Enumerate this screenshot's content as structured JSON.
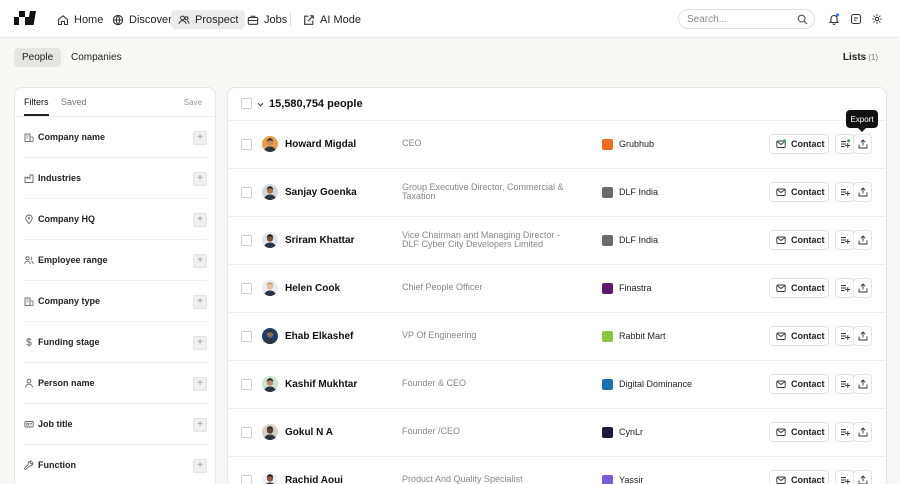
{
  "nav": {
    "items": [
      {
        "label": "Home",
        "icon": "home-icon"
      },
      {
        "label": "Discover",
        "icon": "globe-icon"
      },
      {
        "label": "Prospect",
        "icon": "users-icon",
        "active": true
      },
      {
        "label": "Jobs",
        "icon": "briefcase-icon"
      },
      {
        "label": "AI Mode",
        "icon": "ai-mode-icon"
      }
    ],
    "search_placeholder": "Search..."
  },
  "subnav": {
    "tabs": [
      {
        "label": "People",
        "active": true
      },
      {
        "label": "Companies"
      }
    ],
    "lists_label": "Lists",
    "lists_count": "(1)"
  },
  "filters": {
    "tabs": [
      "Filters",
      "Saved"
    ],
    "save_label": "Save",
    "items": [
      {
        "label": "Company name",
        "icon": "building-icon"
      },
      {
        "label": "Industries",
        "icon": "factory-icon"
      },
      {
        "label": "Company HQ",
        "icon": "location-pin-icon"
      },
      {
        "label": "Employee range",
        "icon": "people-icon"
      },
      {
        "label": "Company type",
        "icon": "building-icon"
      },
      {
        "label": "Funding stage",
        "icon": "dollar-icon"
      },
      {
        "label": "Person name",
        "icon": "person-icon"
      },
      {
        "label": "Job title",
        "icon": "badge-icon"
      },
      {
        "label": "Function",
        "icon": "wrench-icon"
      }
    ]
  },
  "results": {
    "count_label": "15,580,754 people",
    "contact_label": "Contact",
    "tooltip": "Export",
    "rows": [
      {
        "name": "Howard Migdal",
        "title": "CEO",
        "company": "Grubhub",
        "logo_color": "#f26b21"
      },
      {
        "name": "Sanjay Goenka",
        "title": "Group Executive Director, Commercial & Taxation",
        "company": "DLF India",
        "logo_color": "#6b6b6b"
      },
      {
        "name": "Sriram Khattar",
        "title": "Vice Chairman and Managing Director - DLF Cyber City Developers Limited",
        "company": "DLF India",
        "logo_color": "#6b6b6b"
      },
      {
        "name": "Helen Cook",
        "title": "Chief People Officer",
        "company": "Finastra",
        "logo_color": "#5b1a6e"
      },
      {
        "name": "Ehab Elkashef",
        "title": "VP Of Engineering",
        "company": "Rabbit Mart",
        "logo_color": "#8cc63f"
      },
      {
        "name": "Kashif Mukhtar",
        "title": "Founder & CEO",
        "company": "Digital Dominance",
        "logo_color": "#1a6fb0"
      },
      {
        "name": "Gokul N A",
        "title": "Founder /CEO",
        "company": "CynLr",
        "logo_color": "#1b1b3a"
      },
      {
        "name": "Rachid Aoui",
        "title": "Product And Quality Specialist",
        "company": "Yassir",
        "logo_color": "#7b5cd6"
      }
    ]
  }
}
